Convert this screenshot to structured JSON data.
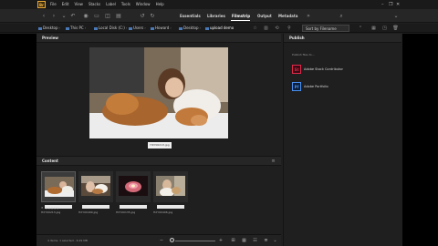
{
  "app": {
    "logo": "Br"
  },
  "menu": [
    "File",
    "Edit",
    "View",
    "Stacks",
    "Label",
    "Tools",
    "Window",
    "Help"
  ],
  "workspaces": [
    "Essentials",
    "Libraries",
    "Filmstrip",
    "Output",
    "Metadata"
  ],
  "active_workspace": "Filmstrip",
  "breadcrumbs": [
    "Desktop",
    "This PC",
    "Local Disk (C:)",
    "Users",
    "Howard",
    "Desktop",
    "upload demo"
  ],
  "sort": {
    "label": "Sort by Filename"
  },
  "preview": {
    "title": "Preview",
    "filename": "HXY00213.jpg"
  },
  "content": {
    "title": "Content",
    "thumbnails": [
      {
        "name": "HXY00213.jpg",
        "selected": true
      },
      {
        "name": "HXY00499.jpg",
        "selected": false
      },
      {
        "name": "HXY00135.jpg",
        "selected": false
      },
      {
        "name": "HXY00406.jpg",
        "selected": false
      }
    ],
    "rating_glyphs": "✕ ○○○○○"
  },
  "status": {
    "text": "4 items, 1 selected - 6.29 MB"
  },
  "publish": {
    "title": "Publish",
    "subtitle": "Publish files to...",
    "items": [
      {
        "icon": "St",
        "label": "Adobe Stock Contributor",
        "color": "#e0294b",
        "bg": "#3a0a14"
      },
      {
        "icon": "Pf",
        "label": "Adobe Portfolio",
        "color": "#4a90f0",
        "bg": "#0c1f3a"
      }
    ]
  },
  "colors": {
    "accent": "#e8a93b",
    "panel": "#1f1f1f",
    "selected_thumb": "#3b3b3b"
  }
}
